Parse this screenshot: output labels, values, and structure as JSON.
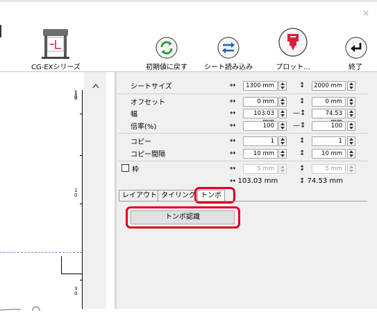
{
  "window": {
    "close_glyph": "×"
  },
  "toolbar": {
    "device_label": "CG-EXシリーズ",
    "reset_label": "初期値に戻す",
    "read_sheet_label": "シート読み込み",
    "plot_label": "プロット...",
    "exit_label": "終了"
  },
  "ruler": {
    "mark_1": "1",
    "mark_2": "1",
    "mark_3": "3",
    "sub": "0"
  },
  "settings": {
    "sheet_size": {
      "label": "シートサイズ",
      "width": "1300 mm",
      "height": "2000 mm"
    },
    "offset": {
      "label": "オフセット",
      "x": "0 mm",
      "y": "0 mm"
    },
    "width": {
      "label": "幅",
      "width": "103.03 mm",
      "height": "74.53 mm"
    },
    "scale": {
      "label": "倍率(%)",
      "x": "100",
      "y": "100"
    },
    "copies": {
      "label": "コピー",
      "x": "1",
      "y": "1"
    },
    "copy_spacing": {
      "label": "コピー間隔",
      "x": "10 mm",
      "y": "10 mm"
    },
    "frame": {
      "label": "枠",
      "checked": false,
      "x": "5 mm",
      "y": "5 mm"
    },
    "summary": {
      "width": "↔ 103.03 mm",
      "height": "↕ 74.53 mm"
    }
  },
  "symbols": {
    "horizontal": "↔",
    "vertical": "↕",
    "link": "—↕"
  },
  "tabs": [
    {
      "label": "レイアウト"
    },
    {
      "label": "タイリング"
    },
    {
      "label": "トンボ",
      "selected": true
    }
  ],
  "trimmark_panel": {
    "recognize_button": "トンボ認識"
  },
  "colors": {
    "highlight": "#e0001b",
    "reset_icon": "#2e9e3a",
    "read_icon": "#2361b8",
    "plot_icon": "#d8203a"
  }
}
